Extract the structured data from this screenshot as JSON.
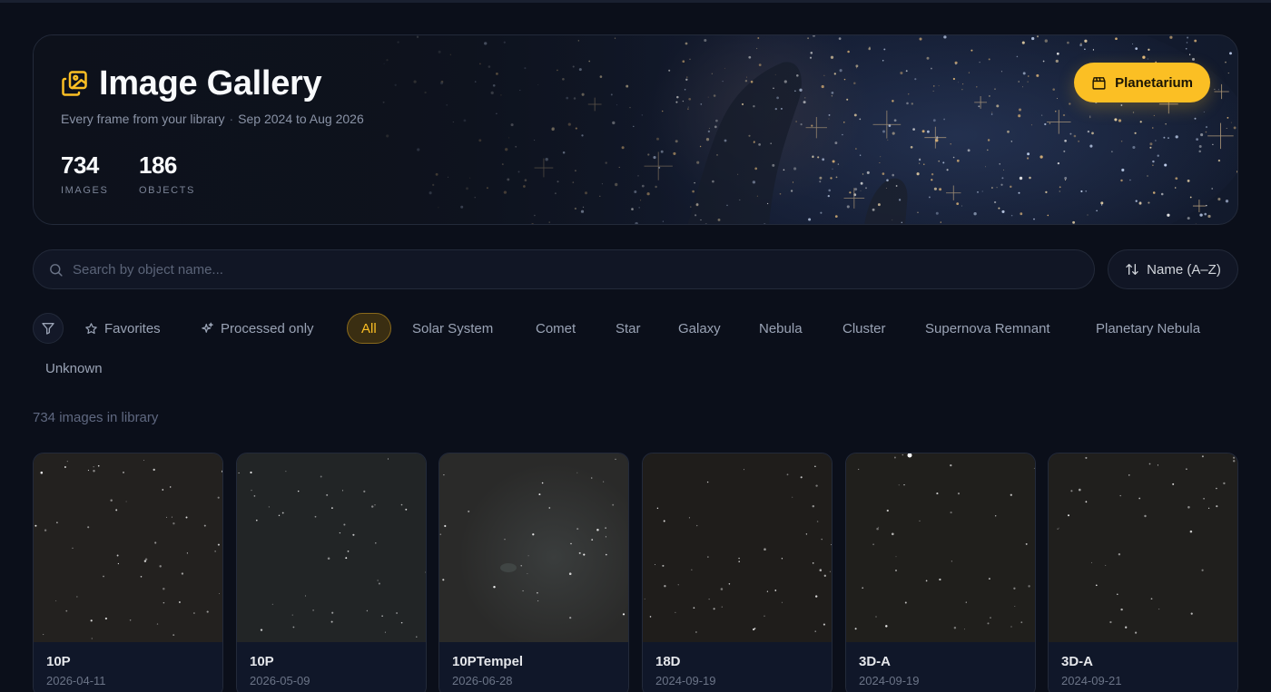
{
  "hero": {
    "title": "Image Gallery",
    "subtitle": "Every frame from your library",
    "date_range": "Sep 2024 to Aug 2026",
    "stats": [
      {
        "value": "734",
        "label": "IMAGES"
      },
      {
        "value": "186",
        "label": "OBJECTS"
      }
    ],
    "planetarium_label": "Planetarium",
    "icons": {
      "title": "gallery-icon",
      "planetarium": "clapperboard-icon"
    }
  },
  "search": {
    "placeholder": "Search by object name...",
    "value": ""
  },
  "sort": {
    "label": "Name (A–Z)"
  },
  "filters": {
    "favorites": "Favorites",
    "processed": "Processed only",
    "categories": [
      "All",
      "Solar System",
      "Comet",
      "Star",
      "Galaxy",
      "Nebula",
      "Cluster",
      "Supernova Remnant",
      "Planetary Nebula",
      "Unknown"
    ],
    "active": "All"
  },
  "count_text": "734 images in library",
  "cards": [
    {
      "name": "10P",
      "date": "2026-04-11"
    },
    {
      "name": "10P",
      "date": "2026-05-09"
    },
    {
      "name": "10PTempel",
      "date": "2026-06-28"
    },
    {
      "name": "18D",
      "date": "2024-09-19"
    },
    {
      "name": "3D-A",
      "date": "2024-09-19"
    },
    {
      "name": "3D-A",
      "date": "2024-09-21"
    }
  ],
  "colors": {
    "accent": "#fbbf24",
    "background": "#0b0f1a",
    "panel": "#111625"
  }
}
